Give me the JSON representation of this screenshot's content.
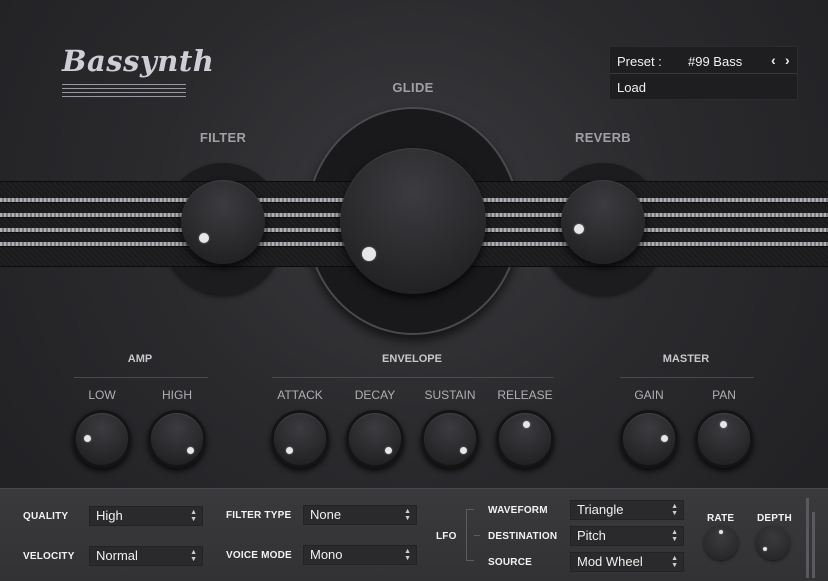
{
  "app": {
    "logo": "Bassynth"
  },
  "preset": {
    "label": "Preset :",
    "value": "#99 Bass",
    "prev": "‹",
    "next": "›",
    "load": "Load"
  },
  "main_knobs": {
    "filter": "FILTER",
    "glide": "GLIDE",
    "reverb": "REVERB"
  },
  "amp": {
    "title": "AMP",
    "low": "LOW",
    "high": "HIGH"
  },
  "envelope": {
    "title": "ENVELOPE",
    "attack": "ATTACK",
    "decay": "DECAY",
    "sustain": "SUSTAIN",
    "release": "RELEASE"
  },
  "master": {
    "title": "MASTER",
    "gain": "GAIN",
    "pan": "PAN"
  },
  "settings": {
    "quality_label": "QUALITY",
    "quality_value": "High",
    "velocity_label": "VELOCITY",
    "velocity_value": "Normal",
    "filter_type_label": "FILTER TYPE",
    "filter_type_value": "None",
    "voice_mode_label": "VOICE MODE",
    "voice_mode_value": "Mono"
  },
  "lfo": {
    "label": "LFO",
    "waveform_label": "WAVEFORM",
    "waveform_value": "Triangle",
    "destination_label": "DESTINATION",
    "destination_value": "Pitch",
    "source_label": "SOURCE",
    "source_value": "Mod Wheel",
    "rate_label": "RATE",
    "depth_label": "DEPTH"
  },
  "colors": {
    "background": "#2a2a2d",
    "panel": "#3a3a3d",
    "indicator": "#e6e6e8"
  },
  "arrows_glyph": "▲▼"
}
